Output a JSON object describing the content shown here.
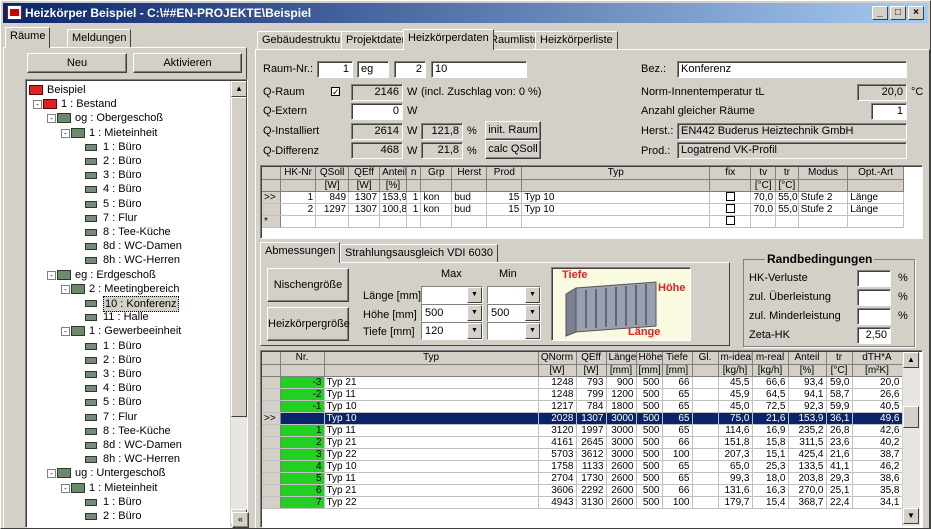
{
  "window": {
    "title": "Heizkörper Beispiel - C:\\##EN-PROJEKTE\\Beispiel"
  },
  "left": {
    "tabs": [
      "Räume",
      "Meldungen"
    ],
    "buttons": {
      "new": "Neu",
      "activate": "Aktivieren"
    },
    "tree": [
      {
        "label": "Beispiel",
        "level": 0,
        "icon": "house"
      },
      {
        "label": "1 : Bestand",
        "level": 1,
        "icon": "house",
        "exp": "-"
      },
      {
        "label": "og : Obergeschoß",
        "level": 2,
        "icon": "floor",
        "exp": "-"
      },
      {
        "label": "1 : Mieteinheit",
        "level": 3,
        "icon": "unit",
        "exp": "-"
      },
      {
        "label": "1 : Büro",
        "level": 4,
        "icon": "room"
      },
      {
        "label": "2 : Büro",
        "level": 4,
        "icon": "room"
      },
      {
        "label": "3 : Büro",
        "level": 4,
        "icon": "room"
      },
      {
        "label": "4 : Büro",
        "level": 4,
        "icon": "room"
      },
      {
        "label": "5 : Büro",
        "level": 4,
        "icon": "room"
      },
      {
        "label": "7 : Flur",
        "level": 4,
        "icon": "room"
      },
      {
        "label": "8 : Tee-Küche",
        "level": 4,
        "icon": "room"
      },
      {
        "label": "8d : WC-Damen",
        "level": 4,
        "icon": "room"
      },
      {
        "label": "8h : WC-Herren",
        "level": 4,
        "icon": "room"
      },
      {
        "label": "eg : Erdgeschoß",
        "level": 2,
        "icon": "floor",
        "exp": "-"
      },
      {
        "label": "2 : Meetingbereich",
        "level": 3,
        "icon": "unit",
        "exp": "-"
      },
      {
        "label": "10 : Konferenz",
        "level": 4,
        "icon": "room",
        "selected": true
      },
      {
        "label": "11 : Halle",
        "level": 4,
        "icon": "room"
      },
      {
        "label": "1 : Gewerbeeinheit",
        "level": 3,
        "icon": "unit",
        "exp": "-"
      },
      {
        "label": "1 : Büro",
        "level": 4,
        "icon": "room"
      },
      {
        "label": "2 : Büro",
        "level": 4,
        "icon": "room"
      },
      {
        "label": "3 : Büro",
        "level": 4,
        "icon": "room"
      },
      {
        "label": "4 : Büro",
        "level": 4,
        "icon": "room"
      },
      {
        "label": "5 : Büro",
        "level": 4,
        "icon": "room"
      },
      {
        "label": "7 : Flur",
        "level": 4,
        "icon": "room"
      },
      {
        "label": "8 : Tee-Küche",
        "level": 4,
        "icon": "room"
      },
      {
        "label": "8d : WC-Damen",
        "level": 4,
        "icon": "room"
      },
      {
        "label": "8h : WC-Herren",
        "level": 4,
        "icon": "room"
      },
      {
        "label": "ug : Untergeschoß",
        "level": 2,
        "icon": "floor",
        "exp": "-"
      },
      {
        "label": "1 : Mieteinheit",
        "level": 3,
        "icon": "unit",
        "exp": "-"
      },
      {
        "label": "1 : Büro",
        "level": 4,
        "icon": "room"
      },
      {
        "label": "2 : Büro",
        "level": 4,
        "icon": "room"
      }
    ]
  },
  "tabs": [
    "Gebäudestruktur",
    "Projektdaten",
    "Heizkörperdaten",
    "Raumliste",
    "Heizkörperliste"
  ],
  "form": {
    "raum_nr_label": "Raum-Nr.:",
    "raum_nr": [
      "1",
      "eg",
      "2",
      "10"
    ],
    "qraum_label": "Q-Raum",
    "qraum_checked": true,
    "qraum_value": "2146",
    "qraum_note": "(incl. Zuschlag von: 0 %)",
    "qextern_label": "Q-Extern",
    "qextern_value": "0",
    "qinst_label": "Q-Installiert",
    "qinst_value": "2614",
    "qinst_pct": "121,8",
    "qdiff_label": "Q-Differenz",
    "qdiff_value": "468",
    "qdiff_pct": "21,8",
    "unit_w": "W",
    "unit_pct": "%",
    "btn_init": "init. Raum",
    "btn_calc": "calc QSoll",
    "bez_label": "Bez.:",
    "bez_value": "Konferenz",
    "norm_label": "Norm-Innentemperatur tL",
    "norm_value": "20,0",
    "norm_unit": "°C",
    "anzahl_label": "Anzahl gleicher Räume",
    "anzahl_value": "1",
    "herst_label": "Herst.:",
    "herst_value": "EN442 Buderus Heiztechnik GmbH",
    "prod_label": "Prod.:",
    "prod_value": "Logatrend VK-Profil"
  },
  "hk_table": {
    "headers": [
      "HK-Nr",
      "QSoll",
      "QEff",
      "Anteil",
      "n",
      "Grp",
      "Herst",
      "Prod",
      "Typ",
      "fix",
      "tv",
      "tr",
      "Modus",
      "Opt.-Art"
    ],
    "units": [
      "",
      "[W]",
      "[W]",
      "[%]",
      "",
      "",
      "",
      "",
      "",
      "",
      "[°C]",
      "[°C]",
      "",
      ""
    ],
    "rows": [
      {
        "mark": ">>",
        "cells": [
          "1",
          "849",
          "1307",
          "153,9",
          "1",
          "kon",
          "bud",
          "15",
          "Typ 10",
          "",
          "70,0",
          "55,0",
          "Stufe 2",
          "Länge"
        ]
      },
      {
        "mark": "",
        "cells": [
          "2",
          "1297",
          "1307",
          "100,8",
          "1",
          "kon",
          "bud",
          "15",
          "Typ 10",
          "",
          "70,0",
          "55,0",
          "Stufe 2",
          "Länge"
        ]
      },
      {
        "mark": "*",
        "cells": [
          "",
          "",
          "",
          "",
          "",
          "",
          "",
          "",
          "",
          "",
          "",
          "",
          "",
          ""
        ]
      }
    ]
  },
  "subtabs": [
    "Abmessungen",
    "Strahlungsausgleich VDI 6030"
  ],
  "dims": {
    "btn_nische": "Nischengröße",
    "btn_hk": "Heizkörpergröße",
    "max_label": "Max",
    "min_label": "Min",
    "laenge_label": "Länge [mm]",
    "hoehe_label": "Höhe [mm]",
    "tiefe_label": "Tiefe [mm]",
    "laenge_max": "",
    "laenge_min": "",
    "hoehe_max": "500",
    "hoehe_min": "500",
    "tiefe_max": "120",
    "tiefe_min": "",
    "img_tiefe": "Tiefe",
    "img_hoehe": "Höhe",
    "img_laenge": "Länge"
  },
  "rand": {
    "title": "Randbedingungen",
    "rows": [
      {
        "label": "HK-Verluste",
        "value": "",
        "unit": "%"
      },
      {
        "label": "zul. Überleistung",
        "value": "",
        "unit": "%"
      },
      {
        "label": "zul. Minderleistung",
        "value": "",
        "unit": "%"
      },
      {
        "label": "Zeta-HK",
        "value": "2,50",
        "unit": ""
      }
    ]
  },
  "bottom_table": {
    "headers": [
      "Nr.",
      "Typ",
      "QNorm",
      "QEff",
      "Länge",
      "Höhe",
      "Tiefe",
      "Gl.",
      "m-ideal",
      "m-real",
      "Anteil",
      "tr",
      "dTH*A"
    ],
    "units": [
      "",
      "",
      "[W]",
      "[W]",
      "[mm]",
      "[mm]",
      "[mm]",
      "",
      "[kg/h]",
      "[kg/h]",
      "[%]",
      "[°C]",
      "[m²K]"
    ],
    "rows": [
      {
        "nr": "-3",
        "cells": [
          "Typ 21",
          "1248",
          "793",
          "900",
          "500",
          "66",
          "",
          "45,5",
          "66,6",
          "93,4",
          "59,0",
          "20,0"
        ]
      },
      {
        "nr": "-2",
        "cells": [
          "Typ 11",
          "1248",
          "799",
          "1200",
          "500",
          "65",
          "",
          "45,9",
          "64,5",
          "94,1",
          "58,7",
          "26,6"
        ]
      },
      {
        "nr": "-1",
        "cells": [
          "Typ 10",
          "1217",
          "784",
          "1800",
          "500",
          "65",
          "",
          "45,0",
          "72,5",
          "92,3",
          "59,9",
          "40,5"
        ]
      },
      {
        "nr": "",
        "mark": ">>",
        "selected": true,
        "cells": [
          "Typ 10",
          "2028",
          "1307",
          "3000",
          "500",
          "65",
          "",
          "75,0",
          "21,6",
          "153,9",
          "36,1",
          "49,6"
        ]
      },
      {
        "nr": "1",
        "cells": [
          "Typ 11",
          "3120",
          "1997",
          "3000",
          "500",
          "65",
          "",
          "114,6",
          "16,9",
          "235,2",
          "26,8",
          "42,6"
        ]
      },
      {
        "nr": "2",
        "cells": [
          "Typ 21",
          "4161",
          "2645",
          "3000",
          "500",
          "66",
          "",
          "151,8",
          "15,8",
          "311,5",
          "23,6",
          "40,2"
        ]
      },
      {
        "nr": "3",
        "cells": [
          "Typ 22",
          "5703",
          "3612",
          "3000",
          "500",
          "100",
          "",
          "207,3",
          "15,1",
          "425,4",
          "21,6",
          "38,7"
        ]
      },
      {
        "nr": "4",
        "cells": [
          "Typ 10",
          "1758",
          "1133",
          "2600",
          "500",
          "65",
          "",
          "65,0",
          "25,3",
          "133,5",
          "41,1",
          "46,2"
        ]
      },
      {
        "nr": "5",
        "cells": [
          "Typ 11",
          "2704",
          "1730",
          "2600",
          "500",
          "65",
          "",
          "99,3",
          "18,0",
          "203,8",
          "29,3",
          "38,6"
        ]
      },
      {
        "nr": "6",
        "cells": [
          "Typ 21",
          "3606",
          "2292",
          "2600",
          "500",
          "66",
          "",
          "131,6",
          "16,3",
          "270,0",
          "25,1",
          "35,8"
        ]
      },
      {
        "nr": "7",
        "cells": [
          "Typ 22",
          "4943",
          "3130",
          "2600",
          "500",
          "100",
          "",
          "179,7",
          "15,4",
          "368,7",
          "22,4",
          "34,1"
        ]
      }
    ]
  },
  "colors": {
    "titlebar": "#0a246a",
    "selection": "#0a246a",
    "indicator": "#22d022"
  }
}
